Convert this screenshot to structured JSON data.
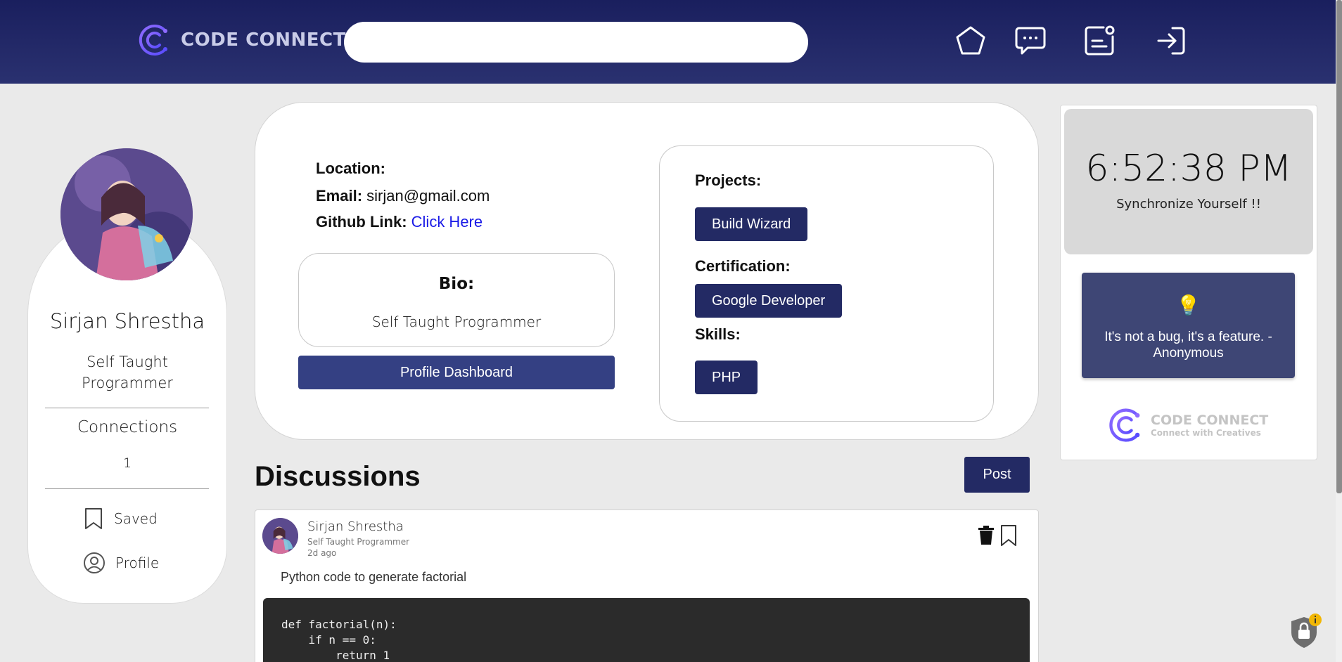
{
  "header": {
    "logo_text": "CODE CONNECT",
    "search": {
      "value": "",
      "placeholder": ""
    },
    "nav": [
      "home-icon",
      "messages-icon",
      "notifications-icon",
      "logout-icon"
    ]
  },
  "profile_card": {
    "name": "Sirjan Shrestha",
    "bio": "Self Taught Programmer",
    "connections_label": "Connections",
    "connections_count": "1",
    "saved_label": "Saved",
    "profile_label": "Profile"
  },
  "details": {
    "location_label": "Location:",
    "location_value": "",
    "email_label": "Email:",
    "email_value": "sirjan@gmail.com",
    "github_label": "Github Link:",
    "github_link_text": "Click Here",
    "bio_title": "Bio:",
    "bio_text": "Self Taught Programmer",
    "dashboard_button": "Profile Dashboard",
    "projects_label": "Projects:",
    "projects": [
      "Build Wizard"
    ],
    "certification_label": "Certification:",
    "certifications": [
      "Google Developer"
    ],
    "skills_label": "Skills:",
    "skills": [
      "PHP"
    ]
  },
  "discussions": {
    "title": "Discussions",
    "post_button": "Post",
    "posts": [
      {
        "author": "Sirjan Shrestha",
        "subtitle": "Self Taught Programmer",
        "time": "2d ago",
        "text": "Python code to generate factorial",
        "code": "def factorial(n):\n    if n == 0:\n        return 1"
      }
    ]
  },
  "sidebar": {
    "clock_time": "6:52:38 PM",
    "clock_tagline": "Synchronize Yourself !!",
    "quote_icon": "💡",
    "quote": "It's not a bug, it's a feature. - Anonymous",
    "logo_title": "CODE CONNECT",
    "logo_subtitle": "Connect with Creatives"
  },
  "colors": {
    "header_bg": "#1a1f5e",
    "primary_button": "#232a64",
    "dashboard_button": "#344083",
    "quote_bg": "#3e4675",
    "link": "#1a1ae6",
    "logo_accent": "#7b61ff"
  }
}
